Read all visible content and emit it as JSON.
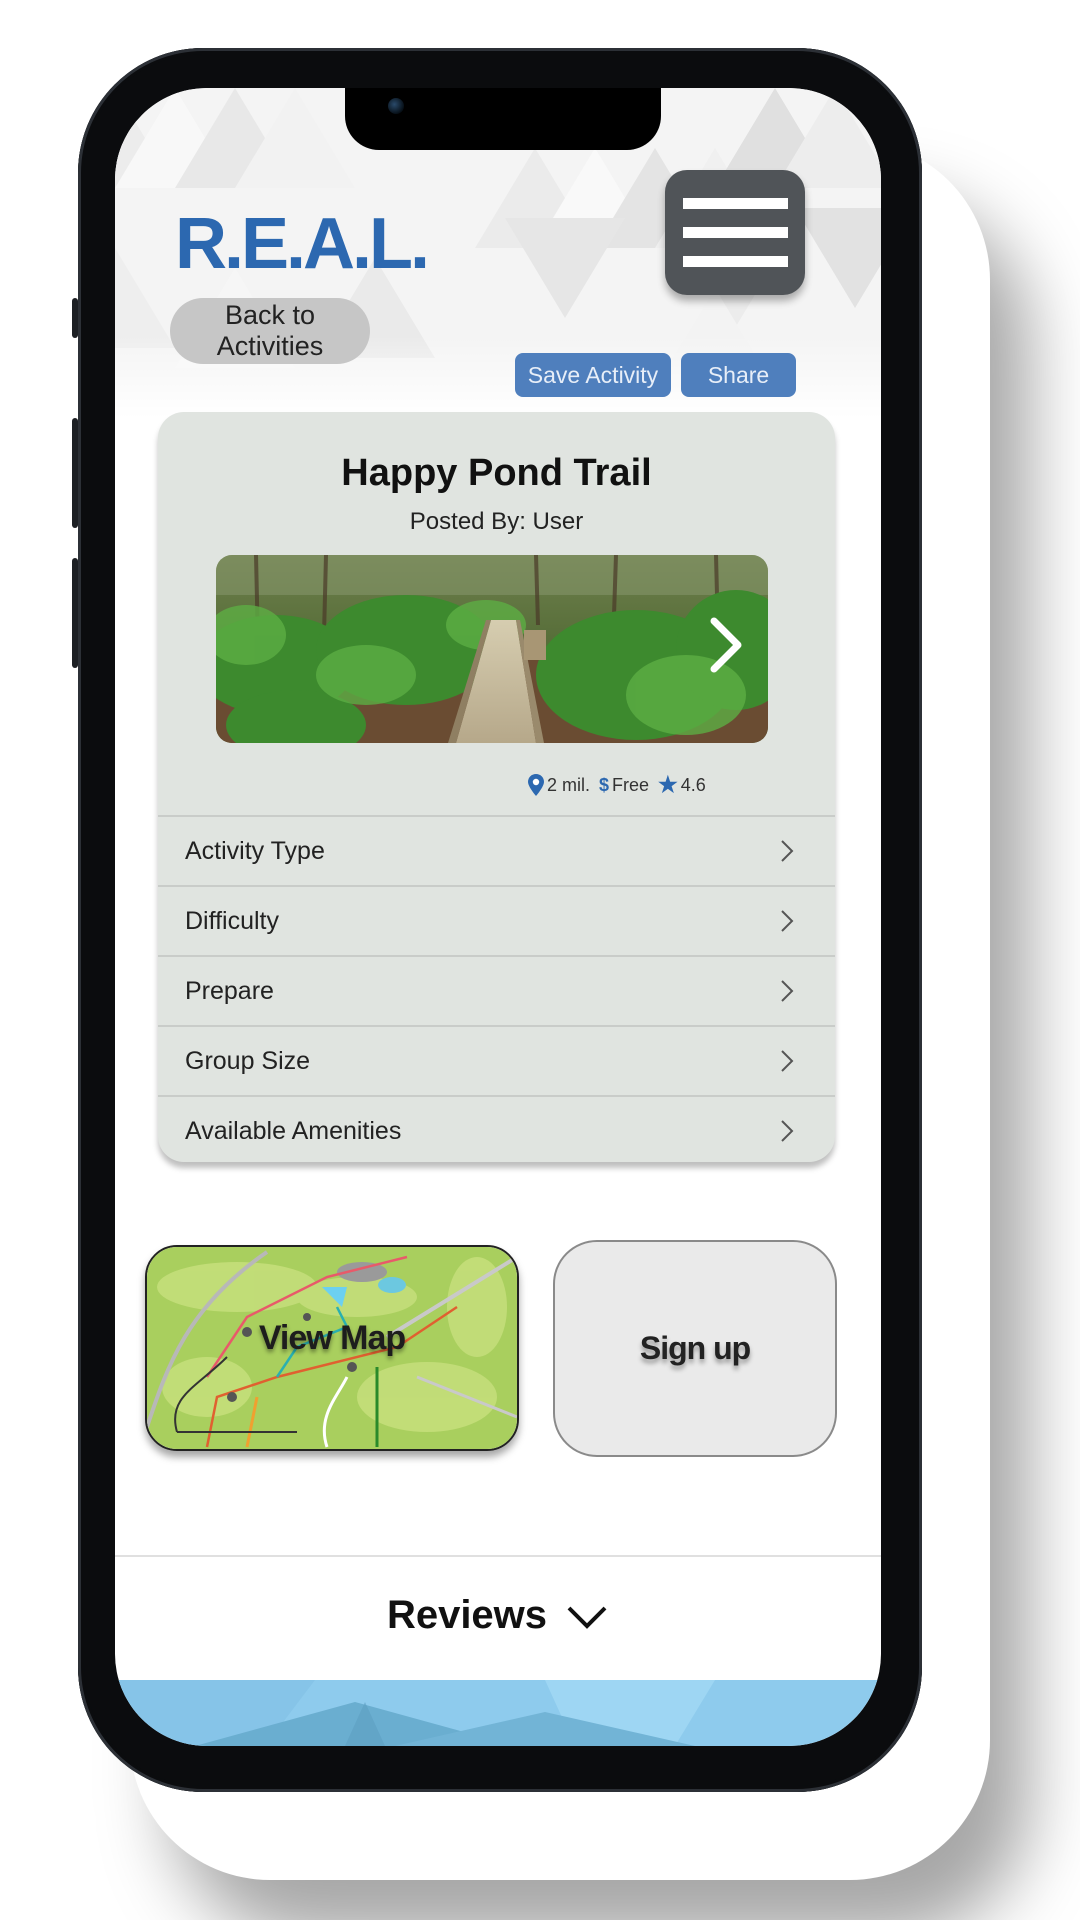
{
  "app": {
    "logo": "R.E.A.L.",
    "brand_color": "#2c68b0",
    "button_color": "#4f7fbd"
  },
  "header": {
    "back_label": "Back to Activities",
    "save_label": "Save Activity",
    "share_label": "Share",
    "menu_icon": "hamburger-menu-icon"
  },
  "activity": {
    "title": "Happy Pond Trail",
    "posted_by": "Posted By: User",
    "photo_alt": "Wooden boardwalk through palmetto forest",
    "photo_next_icon": "chevron-right-icon",
    "stats": {
      "distance": "2 mil.",
      "price_symbol": "$",
      "price": "Free",
      "rating": "4.6"
    },
    "details": [
      {
        "label": "Activity Type"
      },
      {
        "label": "Difficulty"
      },
      {
        "label": "Prepare"
      },
      {
        "label": "Group Size"
      },
      {
        "label": "Available Amenities"
      }
    ]
  },
  "actions": {
    "map_label": "View Map",
    "signup_label": "Sign up"
  },
  "reviews": {
    "label": "Reviews"
  }
}
